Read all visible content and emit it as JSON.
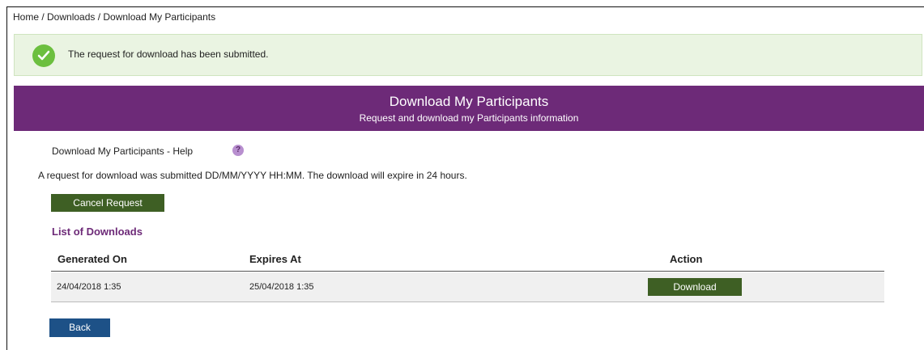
{
  "breadcrumb": "Home / Downloads / Download My Participants",
  "alert": {
    "icon": "check-icon",
    "message": "The request for download has been submitted.",
    "color": "#6cbf3f"
  },
  "banner": {
    "title": "Download My Participants",
    "subtitle": "Request and download my Participants information",
    "color": "#6d2a78"
  },
  "help": {
    "label": "Download My Participants - Help",
    "icon_glyph": "?"
  },
  "info_text": "A request for download was submitted DD/MM/YYYY HH:MM. The download will expire in 24 hours.",
  "cancel_button": "Cancel Request",
  "list_title": "List of Downloads",
  "table": {
    "headers": [
      "Generated On",
      "Expires At",
      "Action"
    ],
    "rows": [
      {
        "generated_on": "24/04/2018 1:35",
        "expires_at": "25/04/2018 1:35",
        "action": "Download"
      }
    ]
  },
  "back_button": "Back",
  "colors": {
    "primary_button": "#3e5f24",
    "back_button": "#1d5187",
    "alert_background": "#eaf4e2"
  }
}
